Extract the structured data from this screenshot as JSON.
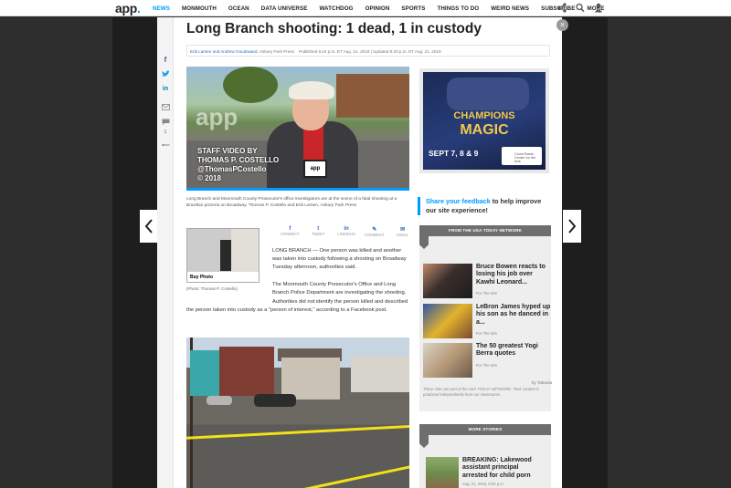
{
  "nav": {
    "logo": "app",
    "logo_dot": ".",
    "items": [
      "NEWS",
      "MONMOUTH",
      "OCEAN",
      "DATA UNIVERSE",
      "WATCHDOG",
      "OPINION",
      "SPORTS",
      "THINGS TO DO",
      "WEIRD NEWS",
      "SUBSCRIBE",
      "MORE"
    ],
    "active_index": 0,
    "icons": [
      "share-icon",
      "search-icon",
      "user-icon"
    ]
  },
  "article": {
    "headline": "Long Branch shooting: 1 dead, 1 in custody",
    "byline_authors": "Erik Larsen and Andrew Goudsward",
    "byline_source": ", Asbury Park Press",
    "byline_published": "Published 6:44 p.m. ET Aug. 21, 2018 | Updated 8:20 p.m. ET Aug. 21, 2018",
    "video": {
      "watermark": "app",
      "credit_line1": "STAFF VIDEO BY",
      "credit_line2": "THOMAS P. COSTELLO",
      "credit_line3": "@ThomasPCostello",
      "credit_line4": "© 2018",
      "mic_label": "app"
    },
    "caption": "Long Branch and Monmouth County Prosecutor's office investigators are at the scene of a fatal shooting at a Brazilian pizzeria on Broadway. Thomas P. Costello and Erik Larsen, Asbury Park Press",
    "share": [
      {
        "sym": "f",
        "label": "CONNECT"
      },
      {
        "sym": "t",
        "label": "TWEET"
      },
      {
        "sym": "in",
        "label": "LINKEDIN"
      },
      {
        "sym": "✎",
        "label": "COMMENT"
      },
      {
        "sym": "✉",
        "label": "EMAIL"
      }
    ],
    "thumb_buy": "Buy Photo",
    "thumb_caption": "(Photo: Thomas P. Costello)",
    "para1": "LONG BRANCH — One person was killed and another was taken into custody following a shooting on Broadway Tuesday afternoon, authorities said.",
    "para2_a": "The Monmouth County Prosecutor's Office and Long Branch Police Department are investigating the shooting.",
    "para2_b": "Authorities did not identify the person killed and described the person taken into custody as a \"person of interest,\" according to a Facebook post."
  },
  "rail_icons": [
    "facebook-icon",
    "twitter-icon",
    "linkedin-icon",
    "email-icon",
    "comment-icon",
    "more-icon"
  ],
  "rail_comment_count": "1",
  "ad": {
    "title1": "CHAMPIONS",
    "title2": "MAGIC",
    "date": "SEPT 7, 8 & 9",
    "org": "Count Basie Center for the Arts"
  },
  "feedback": {
    "link": "Share your feedback",
    "rest": " to help improve our site experience!"
  },
  "network": {
    "heading": "FROM THE USA TODAY NETWORK",
    "stories": [
      {
        "title": "Bruce Bowen reacts to losing his job over Kawhi Leonard...",
        "source": "For The Win"
      },
      {
        "title": "LeBron James hyped up his son as he danced in a...",
        "source": "For The Win"
      },
      {
        "title": "The 50 greatest Yogi Berra quotes",
        "source": "For The Win"
      }
    ],
    "by": "by Taboola",
    "disclaimer": "These sites are part of the USA TODAY NETWORK. Their content is produced independently from our newsrooms."
  },
  "more": {
    "heading": "MORE STORIES",
    "story_title": "BREAKING: Lakewood assistant principal arrested for child porn",
    "story_date": "Aug. 21, 2018, 6:04 p.m."
  },
  "colors": {
    "accent": "#009bff",
    "link": "#2a6ebb",
    "ad_gold": "#f3c84a"
  }
}
